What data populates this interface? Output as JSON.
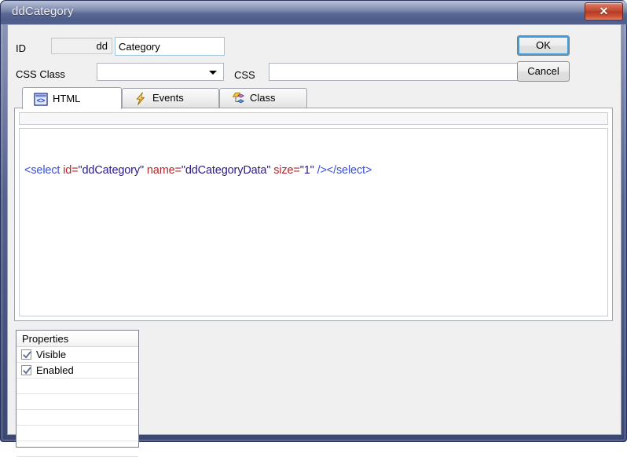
{
  "window": {
    "title": "ddCategory",
    "close_label": "✕"
  },
  "form": {
    "id_label": "ID",
    "id_prefix": "dd",
    "id_value": "Category",
    "css_class_label": "CSS Class",
    "css_class_value": "",
    "css_label": "CSS",
    "css_value": "",
    "ok_label": "OK",
    "cancel_label": "Cancel"
  },
  "tabs": [
    {
      "label": "HTML",
      "icon": "code-brackets-icon",
      "active": true
    },
    {
      "label": "Events",
      "icon": "lightning-bolt-icon",
      "active": false
    },
    {
      "label": "Class",
      "icon": "diamond-shapes-icon",
      "active": false
    }
  ],
  "editor": {
    "code_tokens": [
      {
        "text": "<select ",
        "type": "tag"
      },
      {
        "text": "id=",
        "type": "attr"
      },
      {
        "text": "\"ddCategory\"",
        "type": "val"
      },
      {
        "text": " ",
        "type": "tag"
      },
      {
        "text": "name=",
        "type": "attr"
      },
      {
        "text": "\"ddCategoryData\"",
        "type": "val"
      },
      {
        "text": " ",
        "type": "tag"
      },
      {
        "text": "size=",
        "type": "attr"
      },
      {
        "text": "\"1\"",
        "type": "val"
      },
      {
        "text": " /></select>",
        "type": "tag"
      }
    ]
  },
  "properties": {
    "header": "Properties",
    "rows": [
      {
        "label": "Visible",
        "checked": true
      },
      {
        "label": "Enabled",
        "checked": true
      },
      {
        "label": "",
        "checked": null
      },
      {
        "label": "",
        "checked": null
      },
      {
        "label": "",
        "checked": null
      },
      {
        "label": "",
        "checked": null
      },
      {
        "label": "",
        "checked": null
      }
    ]
  },
  "colors": {
    "title_bar": "#5c6a97",
    "close_button": "#c24a32",
    "focus_ring": "#3c9fe3",
    "tag": "#3c4fd8",
    "attr": "#b2262c",
    "value": "#2a1a8c"
  }
}
